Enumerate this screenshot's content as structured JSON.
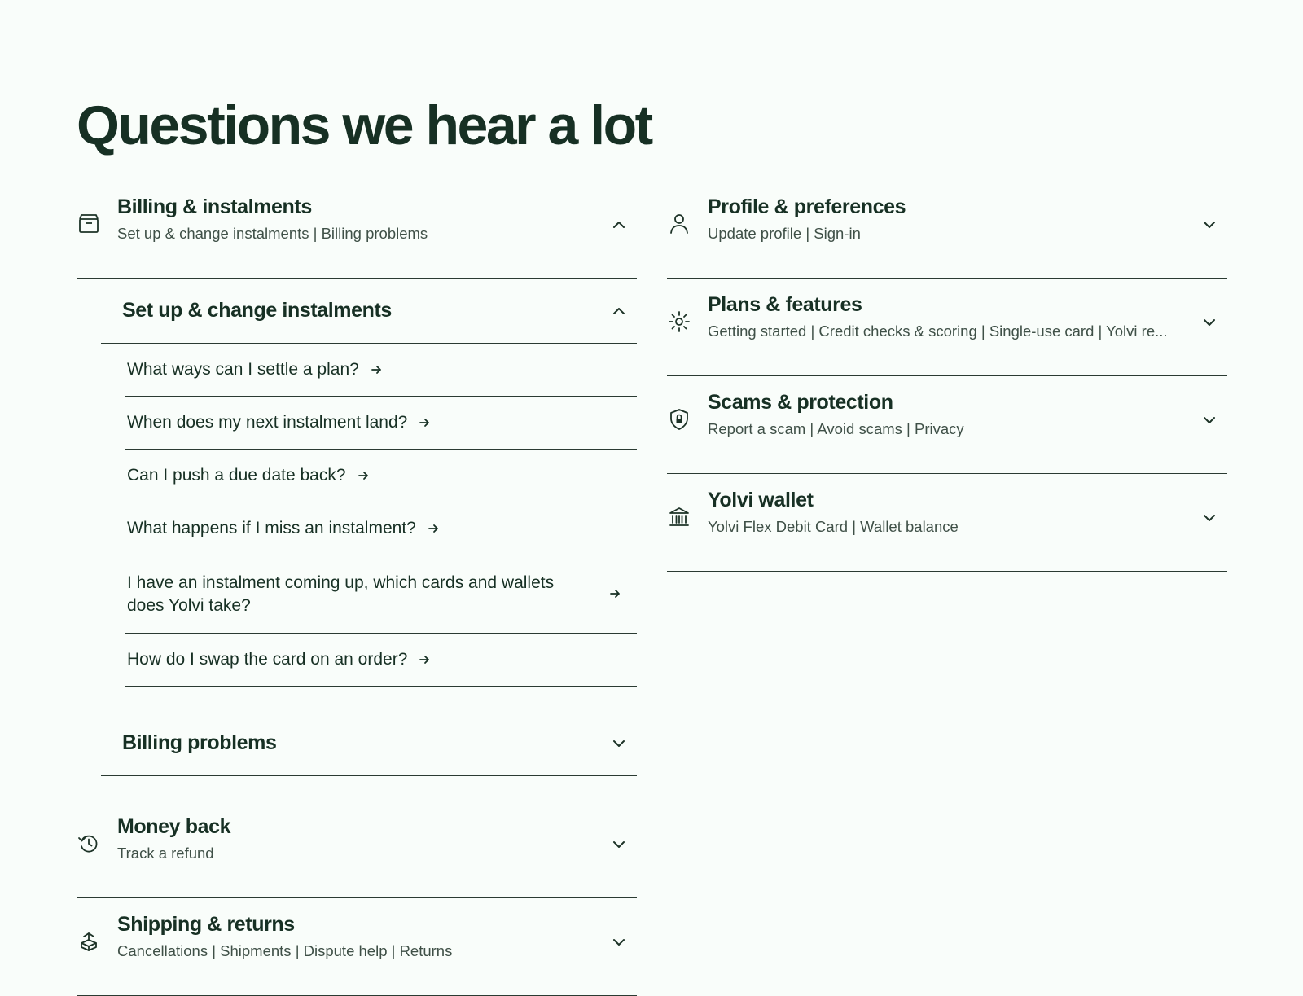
{
  "page": {
    "title": "Questions we hear a lot"
  },
  "left": {
    "billing": {
      "title": "Billing & instalments",
      "subtitle": "Set up & change instalments | Billing problems",
      "icon": "wallet-icon",
      "expanded": true,
      "setup": {
        "title": "Set up & change instalments",
        "expanded": true,
        "questions": [
          "What ways can I settle a plan?",
          "When does my next instalment land?",
          "Can I push a due date back?",
          "What happens if I miss an instalment?",
          "I have an instalment coming up, which cards and wallets does Yolvi take?",
          "How do I swap the card on an order?"
        ]
      },
      "problems": {
        "title": "Billing problems",
        "expanded": false
      }
    },
    "money_back": {
      "title": "Money back",
      "subtitle": "Track a refund",
      "icon": "refund-clock-icon"
    },
    "shipping": {
      "title": "Shipping & returns",
      "subtitle": "Cancellations | Shipments | Dispute help | Returns",
      "icon": "package-icon"
    }
  },
  "right": {
    "profile": {
      "title": "Profile & preferences",
      "subtitle": "Update profile | Sign-in",
      "icon": "user-icon"
    },
    "plans": {
      "title": "Plans & features",
      "subtitle": "Getting started | Credit checks & scoring | Single-use card | Yolvi re...",
      "icon": "sparkle-icon"
    },
    "scams": {
      "title": "Scams & protection",
      "subtitle": "Report a scam | Avoid scams | Privacy",
      "icon": "shield-lock-icon"
    },
    "wallet": {
      "title": "Yolvi wallet",
      "subtitle": "Yolvi Flex Debit Card | Wallet balance",
      "icon": "bank-icon"
    }
  },
  "colors": {
    "background": "#f9fdfa",
    "text": "#173024",
    "muted": "#3f5047",
    "divider": "#2b3b32"
  }
}
